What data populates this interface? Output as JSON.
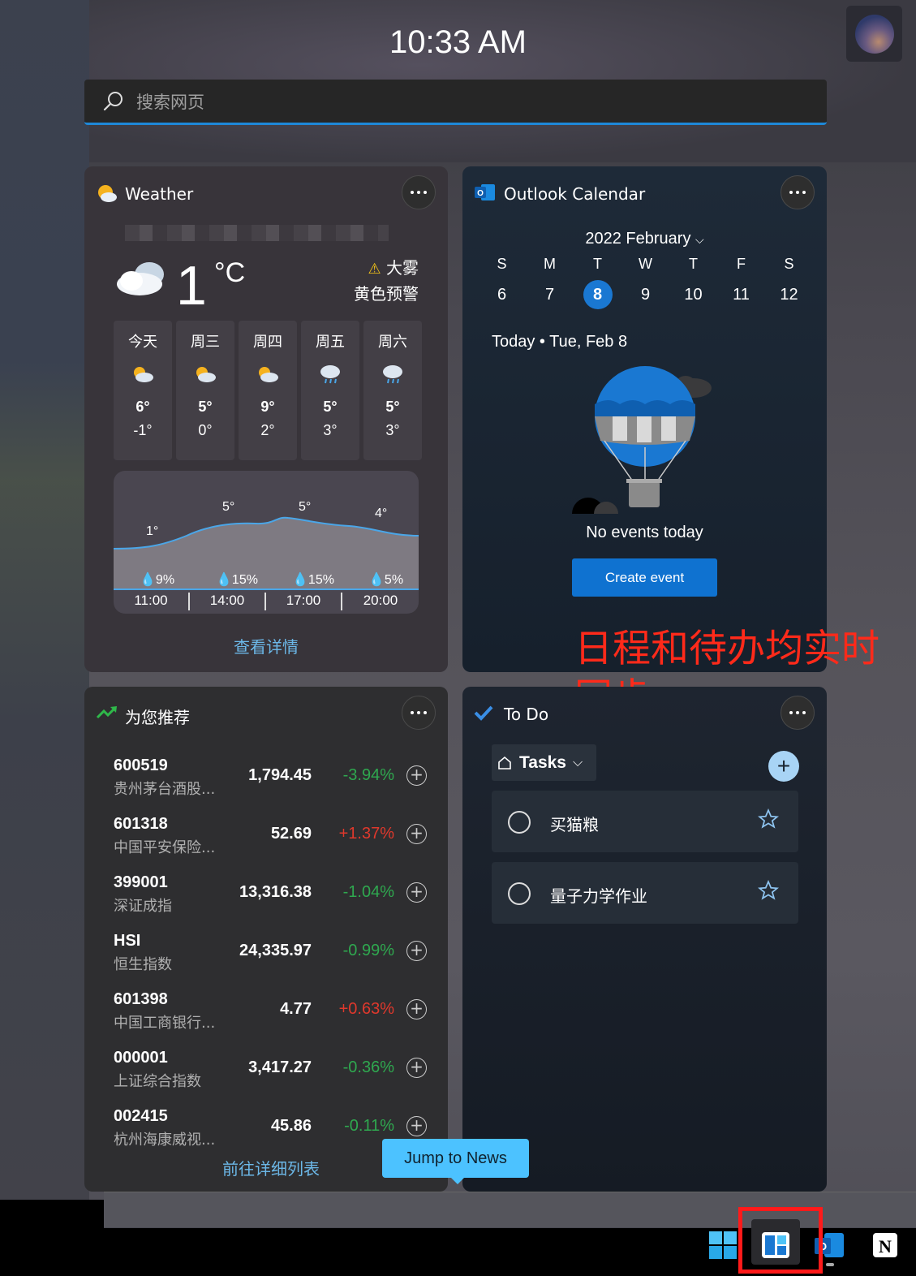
{
  "clock": "10:33 AM",
  "search": {
    "placeholder": "搜索网页"
  },
  "weather": {
    "title": "Weather",
    "temperature": "1",
    "unit": "°C",
    "alert_line1": "大雾",
    "alert_line2": "黄色预警",
    "days": [
      {
        "label": "今天",
        "icon": "partly-sunny-icon",
        "hi": "6°",
        "lo": "-1°"
      },
      {
        "label": "周三",
        "icon": "partly-sunny-icon",
        "hi": "5°",
        "lo": "0°"
      },
      {
        "label": "周四",
        "icon": "partly-sunny-icon",
        "hi": "9°",
        "lo": "2°"
      },
      {
        "label": "周五",
        "icon": "rain-icon",
        "hi": "5°",
        "lo": "3°"
      },
      {
        "label": "周六",
        "icon": "rain-icon",
        "hi": "5°",
        "lo": "3°"
      }
    ],
    "hourly_temps": [
      "1°",
      "5°",
      "5°",
      "4°"
    ],
    "hourly_precip": [
      "9%",
      "15%",
      "15%",
      "5%"
    ],
    "hourly_times": [
      "11:00",
      "14:00",
      "17:00",
      "20:00"
    ],
    "details_link": "查看详情"
  },
  "calendar": {
    "title": "Outlook Calendar",
    "month": "2022 February",
    "weekdays": [
      "S",
      "M",
      "T",
      "W",
      "T",
      "F",
      "S"
    ],
    "dates": [
      "6",
      "7",
      "8",
      "9",
      "10",
      "11",
      "12"
    ],
    "selected_date": "8",
    "today_label": "Today • Tue, Feb 8",
    "no_events": "No events today",
    "create_button": "Create event"
  },
  "annotation": "日程和待办均实时同步",
  "stocks": {
    "title": "为您推荐",
    "rows": [
      {
        "code": "600519",
        "name": "贵州茅台酒股...",
        "price": "1,794.45",
        "change": "-3.94%",
        "dir": "down"
      },
      {
        "code": "601318",
        "name": "中国平安保险...",
        "price": "52.69",
        "change": "+1.37%",
        "dir": "up"
      },
      {
        "code": "399001",
        "name": "深证成指",
        "price": "13,316.38",
        "change": "-1.04%",
        "dir": "down"
      },
      {
        "code": "HSI",
        "name": "恒生指数",
        "price": "24,335.97",
        "change": "-0.99%",
        "dir": "down"
      },
      {
        "code": "601398",
        "name": "中国工商银行...",
        "price": "4.77",
        "change": "+0.63%",
        "dir": "up"
      },
      {
        "code": "000001",
        "name": "上证综合指数",
        "price": "3,417.27",
        "change": "-0.36%",
        "dir": "down"
      },
      {
        "code": "002415",
        "name": "杭州海康威视...",
        "price": "45.86",
        "change": "-0.11%",
        "dir": "down"
      }
    ],
    "more_link": "前往详细列表"
  },
  "todo": {
    "title": "To Do",
    "list_name": "Tasks",
    "tasks": [
      {
        "title": "买猫粮"
      },
      {
        "title": "量子力学作业"
      }
    ]
  },
  "jump_button": "Jump to News",
  "colors": {
    "accent": "#1a78d2",
    "stock_down": "#2fa84f",
    "stock_up": "#e0382c",
    "link": "#6cb8e8",
    "annotation": "#ff2a1a"
  }
}
